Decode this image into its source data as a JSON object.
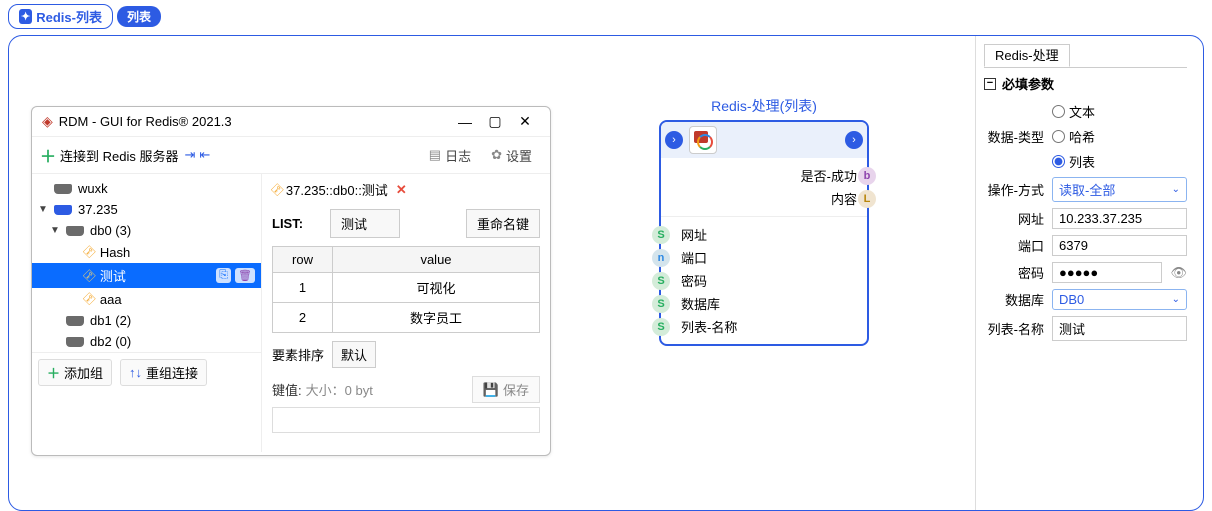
{
  "tabbar": {
    "main_label": "Redis-列表",
    "pill_label": "列表"
  },
  "rdm": {
    "title": "RDM - GUI for Redis® 2021.3",
    "connect_label": "连接到 Redis 服务器",
    "log_label": "日志",
    "settings_label": "设置",
    "tree": {
      "wuxk": "wuxk",
      "s37": "37.235",
      "db0": "db0  (3)",
      "hash": "Hash",
      "test": "测试",
      "aaa": "aaa",
      "db1": "db1  (2)",
      "db2": "db2  (0)",
      "add_group": "添加组",
      "regroup": "重组连接"
    },
    "detail": {
      "path": "37.235::db0::测试",
      "list_label": "LIST:",
      "list_value": "测试",
      "rename_btn": "重命名键",
      "col_row": "row",
      "col_value": "value",
      "rows": [
        {
          "row": "1",
          "value": "可视化"
        },
        {
          "row": "2",
          "value": "数字员工"
        }
      ],
      "sort_label": "要素排序",
      "sort_default": "默认",
      "kv_label": "键值:",
      "kv_size": "大小：0 byt",
      "save_label": "保存"
    }
  },
  "node": {
    "title": "Redis-处理(列表)",
    "out_success": "是否-成功",
    "out_content": "内容",
    "in_url": "网址",
    "in_port": "端口",
    "in_pass": "密码",
    "in_db": "数据库",
    "in_listname": "列表-名称"
  },
  "props": {
    "tab": "Redis-处理",
    "section": "必填参数",
    "data_type_label": "数据-类型",
    "type_text": "文本",
    "type_hash": "哈希",
    "type_list": "列表",
    "op_label": "操作-方式",
    "op_value": "读取-全部",
    "url_label": "网址",
    "url_value": "10.233.37.235",
    "port_label": "端口",
    "port_value": "6379",
    "pass_label": "密码",
    "pass_value": "●●●●●",
    "db_label": "数据库",
    "db_value": "DB0",
    "listname_label": "列表-名称",
    "listname_value": "测试"
  }
}
